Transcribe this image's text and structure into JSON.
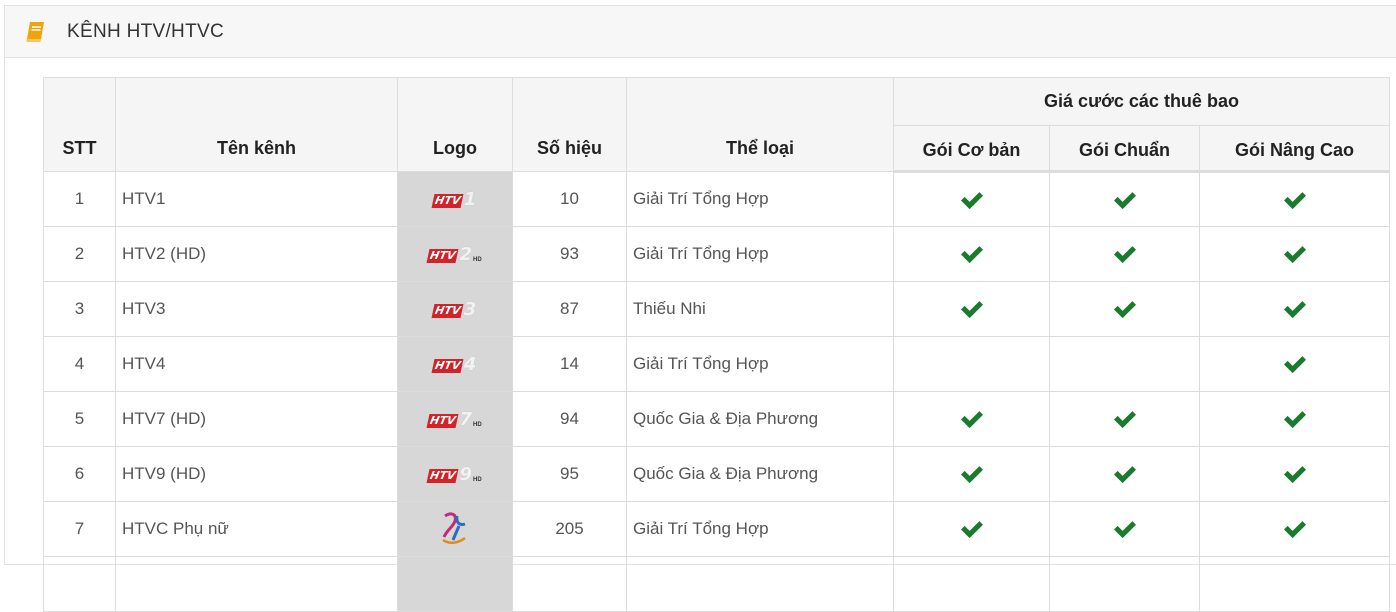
{
  "panel": {
    "title": "KÊNH HTV/HTVC",
    "icon": "book-icon",
    "icon_color": "#f0a30a"
  },
  "table": {
    "headers": {
      "stt": "STT",
      "name": "Tên kênh",
      "logo": "Logo",
      "number": "Số hiệu",
      "genre": "Thể loại",
      "price_group": "Giá cước các thuê bao",
      "packages": [
        "Gói Cơ bản",
        "Gói Chuẩn",
        "Gói Nâng Cao"
      ]
    },
    "check_icon": "check-icon",
    "check_color": "#1a7a2e",
    "rows": [
      {
        "stt": "1",
        "name": "HTV1",
        "logo": {
          "text": "HTV",
          "num": "1",
          "hd": ""
        },
        "number": "10",
        "genre": "Giải Trí Tổng Hợp",
        "basic": true,
        "standard": true,
        "advanced": true
      },
      {
        "stt": "2",
        "name": "HTV2 (HD)",
        "logo": {
          "text": "HTV",
          "num": "2",
          "hd": "HD"
        },
        "number": "93",
        "genre": "Giải Trí Tổng Hợp",
        "basic": true,
        "standard": true,
        "advanced": true
      },
      {
        "stt": "3",
        "name": "HTV3",
        "logo": {
          "text": "HTV",
          "num": "3",
          "hd": ""
        },
        "number": "87",
        "genre": "Thiếu Nhi",
        "basic": true,
        "standard": true,
        "advanced": true
      },
      {
        "stt": "4",
        "name": "HTV4",
        "logo": {
          "text": "HTV",
          "num": "4",
          "hd": ""
        },
        "number": "14",
        "genre": "Giải Trí Tổng Hợp",
        "basic": false,
        "standard": false,
        "advanced": true
      },
      {
        "stt": "5",
        "name": "HTV7 (HD)",
        "logo": {
          "text": "HTV",
          "num": "7",
          "hd": "HD"
        },
        "number": "94",
        "genre": "Quốc Gia & Địa Phương",
        "basic": true,
        "standard": true,
        "advanced": true
      },
      {
        "stt": "6",
        "name": "HTV9 (HD)",
        "logo": {
          "text": "HTV",
          "num": "9",
          "hd": "HD"
        },
        "number": "95",
        "genre": "Quốc Gia & Địa Phương",
        "basic": true,
        "standard": true,
        "advanced": true
      },
      {
        "stt": "7",
        "name": "HTVC Phụ nữ",
        "logo": {
          "type": "phu-nu-logo"
        },
        "number": "205",
        "genre": "Giải Trí Tổng Hợp",
        "basic": true,
        "standard": true,
        "advanced": true
      }
    ]
  }
}
